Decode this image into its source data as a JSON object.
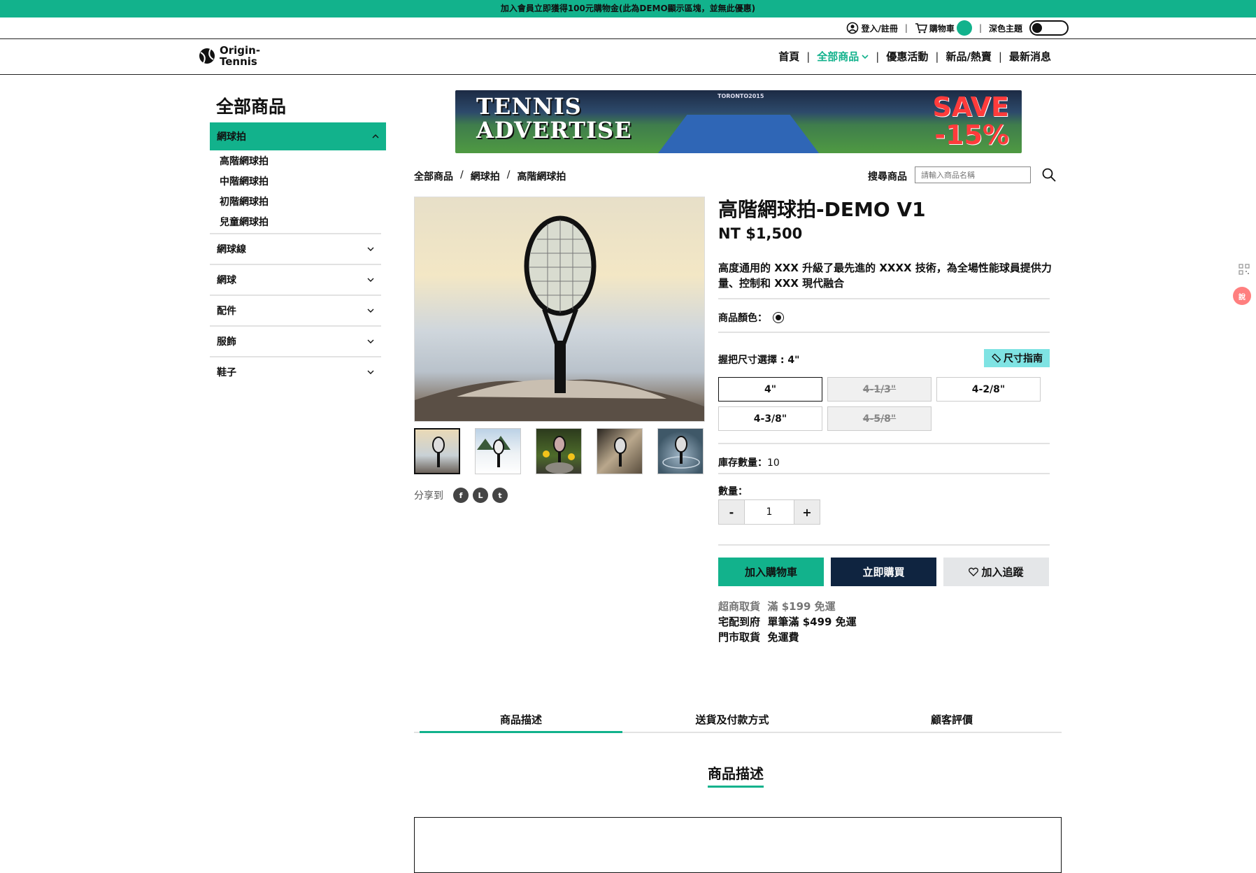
{
  "promo": {
    "text": "加入會員立即獲得100元購物金(此為DEMO顯示區塊，並無此優惠)"
  },
  "utility": {
    "login": "登入/註冊",
    "cart": "購物車",
    "dark_theme": "深色主題",
    "accent": "#12b28c"
  },
  "brand": {
    "line1": "Origin-",
    "line2": "Tennis"
  },
  "nav": {
    "items": [
      "首頁",
      "全部商品",
      "優惠活動",
      "新品/熱賣",
      "最新消息"
    ],
    "active_index": 1
  },
  "sidebar": {
    "title": "全部商品",
    "open_category": "網球拍",
    "subcategories": [
      "高階網球拍",
      "中階網球拍",
      "初階網球拍",
      "兒童網球拍"
    ],
    "categories": [
      "網球線",
      "網球",
      "配件",
      "服飾",
      "鞋子"
    ]
  },
  "banner": {
    "headline_1": "TENNIS",
    "headline_2": "ADVERTISE",
    "save_1": "SAVE",
    "save_2": "-15%",
    "venue": "TORONTO2015"
  },
  "breadcrumb": [
    "全部商品",
    "網球拍",
    "高階網球拍"
  ],
  "search": {
    "label": "搜尋商品",
    "placeholder": "請輸入商品名稱"
  },
  "share": {
    "label": "分享到",
    "icons": [
      "facebook-icon",
      "line-icon",
      "twitter-icon"
    ]
  },
  "product": {
    "title": "高階網球拍-DEMO V1",
    "price": "NT $1,500",
    "description": "高度通用的 XXX 升級了最先進的 XXXX 技術，為全場性能球員提供力量、控制和 XXX 現代融合",
    "color_label": "商品顏色：",
    "grip_label": "握把尺寸選擇 : 4\"",
    "size_guide": "尺寸指南",
    "sizes": [
      {
        "label": "4\"",
        "state": "selected"
      },
      {
        "label": "4-1/3\"",
        "state": "disabled"
      },
      {
        "label": "4-2/8\"",
        "state": "available"
      },
      {
        "label": "4-3/8\"",
        "state": "available"
      },
      {
        "label": "4-5/8\"",
        "state": "disabled"
      }
    ],
    "stock_label": "庫存數量：",
    "stock_value": "10",
    "qty_label": "數量：",
    "qty_minus": "-",
    "qty_value": "1",
    "qty_plus": "+",
    "add_to_cart": "加入購物車",
    "buy_now": "立即購買",
    "add_to_track": "加入追蹤",
    "shipping": [
      {
        "method": "超商取貨",
        "note": "滿 $199 免運"
      },
      {
        "method": "宅配到府",
        "note": "單筆滿 $499 免運"
      },
      {
        "method": "門市取貨",
        "note": "免運費"
      }
    ]
  },
  "tabs": [
    "商品描述",
    "送貨及付款方式",
    "顧客評價"
  ],
  "section_title": "商品描述",
  "floating": {
    "badge": "說"
  }
}
